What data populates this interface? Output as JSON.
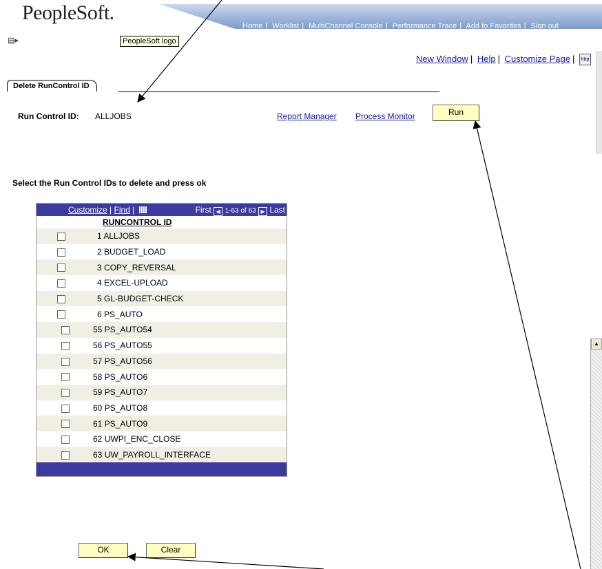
{
  "header": {
    "logo_text": "PeopleSoft.",
    "links": [
      "Home",
      "Worklist",
      "MultiChannel Console",
      "Performance Trace",
      "Add to Favorites",
      "Sign out"
    ],
    "tooltip": "PeopleSoft logo",
    "menu_icon": "▤▸"
  },
  "utility": {
    "new_window": "New Window",
    "help": "Help",
    "customize_page": "Customize Page",
    "http_icon": "http"
  },
  "tab": {
    "label": "Delete RunControl ID"
  },
  "run_control": {
    "label": "Run Control ID:",
    "value": "ALLJOBS",
    "report_manager": "Report Manager",
    "process_monitor": "Process Monitor",
    "run_label": "Run"
  },
  "instruction": "Select the Run Control IDs to delete and press ok",
  "grid": {
    "customize": "Customize",
    "find": "Find",
    "first": "First",
    "range": "1-63 of 63",
    "last": "Last",
    "column_header": "RUNCONTROL ID",
    "rows": [
      {
        "num": "1",
        "id": "ALLJOBS"
      },
      {
        "num": "2",
        "id": "BUDGET_LOAD"
      },
      {
        "num": "3",
        "id": "COPY_REVERSAL"
      },
      {
        "num": "4",
        "id": "EXCEL-UPLOAD"
      },
      {
        "num": "5",
        "id": "GL-BUDGET-CHECK"
      },
      {
        "num": "6",
        "id": "PS_AUTO"
      },
      {
        "num": "55",
        "id": "PS_AUTO54"
      },
      {
        "num": "56",
        "id": "PS_AUTO55"
      },
      {
        "num": "57",
        "id": "PS_AUTO56"
      },
      {
        "num": "58",
        "id": "PS_AUTO6"
      },
      {
        "num": "59",
        "id": "PS_AUTO7"
      },
      {
        "num": "60",
        "id": "PS_AUTO8"
      },
      {
        "num": "61",
        "id": "PS_AUTO9"
      },
      {
        "num": "62",
        "id": "UWPI_ENC_CLOSE"
      },
      {
        "num": "63",
        "id": "UW_PAYROLL_INTERFACE"
      }
    ]
  },
  "buttons": {
    "ok": "OK",
    "clear": "Clear"
  },
  "colors": {
    "grid_header": "#3a3aa0",
    "button_bg": "#ffffc0",
    "link": "#1a1aa6",
    "row_alt": "#f1efe4"
  }
}
